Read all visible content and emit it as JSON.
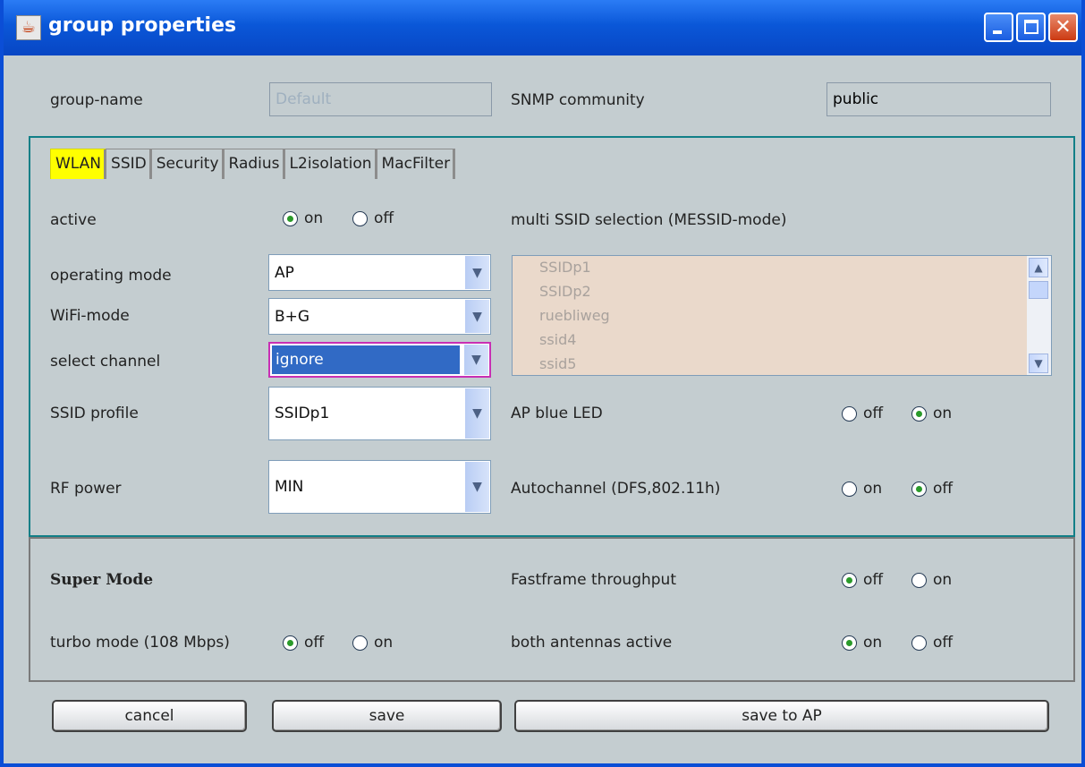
{
  "window": {
    "title": "group properties",
    "app_icon": "java-cup-icon"
  },
  "group_name": {
    "label": "group-name",
    "value": "Default"
  },
  "snmp": {
    "label": "SNMP community",
    "value": "public"
  },
  "tabs": [
    {
      "label": "WLAN",
      "active": true
    },
    {
      "label": "SSID",
      "active": false
    },
    {
      "label": "Security",
      "active": false
    },
    {
      "label": "Radius",
      "active": false
    },
    {
      "label": "L2isolation",
      "active": false
    },
    {
      "label": "MacFilter",
      "active": false
    }
  ],
  "wlan": {
    "active": {
      "label": "active",
      "opt1": "on",
      "opt2": "off",
      "selected": "on"
    },
    "multi_ssid": {
      "label": "multi SSID selection (MESSID-mode)",
      "items": [
        "SSIDp1",
        "SSIDp2",
        "ruebliweg",
        "ssid4",
        "ssid5"
      ]
    },
    "operating_mode": {
      "label": "operating mode",
      "value": "AP"
    },
    "wifi_mode": {
      "label": "WiFi-mode",
      "value": "B+G"
    },
    "select_channel": {
      "label": "select channel",
      "value": "ignore"
    },
    "ssid_profile": {
      "label": "SSID profile",
      "value": "SSIDp1"
    },
    "rf_power": {
      "label": "RF power",
      "value": "MIN"
    },
    "ap_blue_led": {
      "label": "AP blue LED",
      "opt1": "off",
      "opt2": "on",
      "selected": "on"
    },
    "autochannel": {
      "label": "Autochannel (DFS,802.11h)",
      "opt1": "on",
      "opt2": "off",
      "selected": "off"
    }
  },
  "super_mode": {
    "title": "Super Mode",
    "fastframe": {
      "label": "Fastframe throughput",
      "opt1": "off",
      "opt2": "on",
      "selected": "off"
    },
    "turbo": {
      "label": "turbo mode (108 Mbps)",
      "opt1": "off",
      "opt2": "on",
      "selected": "off"
    },
    "antennas": {
      "label": "both antennas active",
      "opt1": "on",
      "opt2": "off",
      "selected": "on"
    }
  },
  "buttons": {
    "cancel": "cancel",
    "save": "save",
    "save_to_ap": "save to AP"
  },
  "colors": {
    "title_bar": "#0a57d8",
    "background": "#c4cdd0",
    "active_tab": "#ffff00",
    "tab_border": "#117f87",
    "listbox_bg": "#ead9cb",
    "selection": "#316ac5",
    "radio_dot": "#2a9a2a"
  }
}
